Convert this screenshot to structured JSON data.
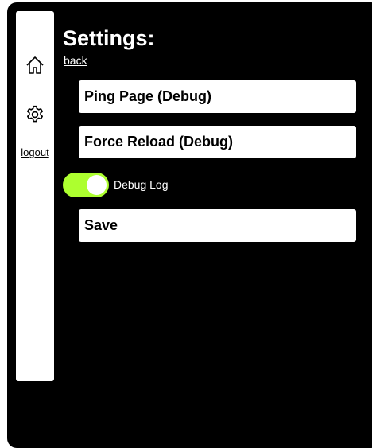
{
  "colors": {
    "background": "#000000",
    "panel": "#ffffff",
    "accent": "#adff2f"
  },
  "sidebar": {
    "items": [
      {
        "icon": "home-icon"
      },
      {
        "icon": "gear-icon"
      }
    ],
    "logout_label": "logout"
  },
  "main": {
    "title": "Settings:",
    "back_label": "back",
    "ping_label": "Ping Page (Debug)",
    "reload_label": "Force Reload (Debug)",
    "debug_toggle": {
      "label": "Debug Log",
      "on": true
    },
    "save_label": "Save"
  }
}
